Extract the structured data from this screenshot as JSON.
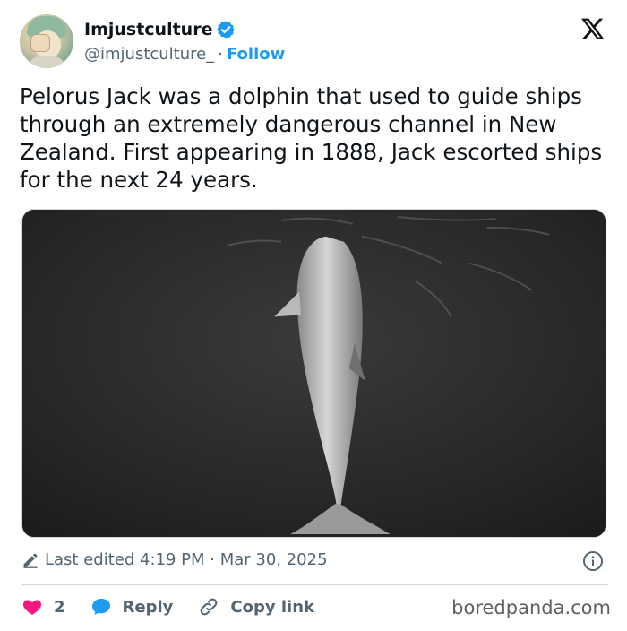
{
  "author": {
    "name": "Imjustculture",
    "handle": "@imjustculture_",
    "separator": "·",
    "follow_label": "Follow"
  },
  "tweet": {
    "text": "Pelorus Jack was a dolphin that used to guide ships through an extremely dangerous channel in New Zealand. First appearing in 1888, Jack escorted ships for the next 24 years."
  },
  "edited": {
    "label": "Last edited 4:19 PM · Mar 30, 2025"
  },
  "actions": {
    "like_count": "2",
    "reply_label": "Reply",
    "copy_link_label": "Copy link"
  },
  "watermark": "boredpanda.com",
  "colors": {
    "accent": "#1d9bf0",
    "like": "#f91880",
    "muted": "#536471"
  },
  "icons": [
    "verified-badge-icon",
    "x-logo-icon",
    "pencil-icon",
    "info-icon",
    "heart-icon",
    "reply-bubble-icon",
    "link-icon"
  ]
}
